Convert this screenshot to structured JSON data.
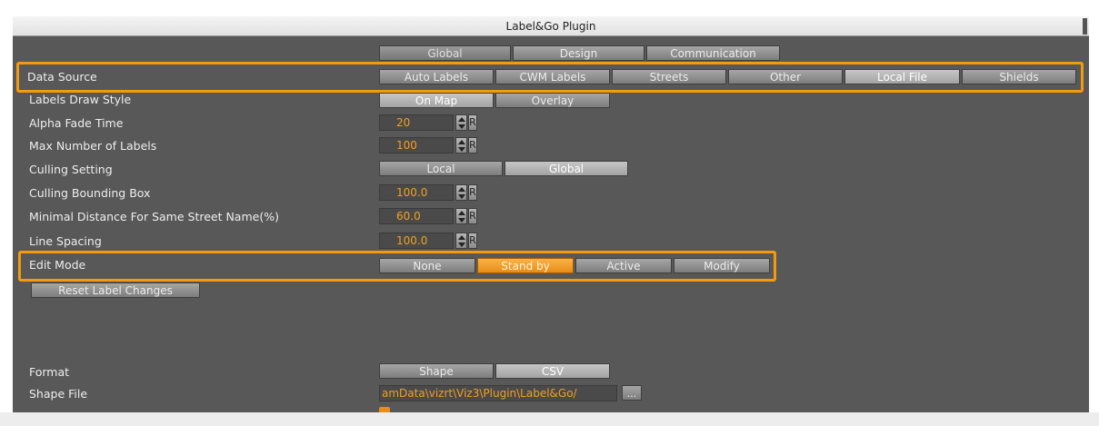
{
  "window": {
    "title": "Label&Go Plugin"
  },
  "tabs": [
    "Global",
    "Design",
    "Communication"
  ],
  "rows": {
    "data_source": {
      "label": "Data Source",
      "options": [
        "Auto Labels",
        "CWM Labels",
        "Streets",
        "Other",
        "Local File",
        "Shields"
      ],
      "selected": "Local File"
    },
    "labels_draw_style": {
      "label": "Labels Draw Style",
      "options": [
        "On Map",
        "Overlay"
      ],
      "selected": "On Map"
    },
    "alpha_fade_time": {
      "label": "Alpha Fade Time",
      "value": "20"
    },
    "max_labels": {
      "label": "Max Number of Labels",
      "value": "100"
    },
    "culling_setting": {
      "label": "Culling Setting",
      "options": [
        "Local",
        "Global"
      ],
      "selected": "Global"
    },
    "culling_bbox": {
      "label": "Culling Bounding Box",
      "value": "100.0"
    },
    "min_distance": {
      "label": "Minimal Distance For Same Street Name(%)",
      "value": "60.0"
    },
    "line_spacing": {
      "label": "Line Spacing",
      "value": "100.0"
    },
    "edit_mode": {
      "label": "Edit Mode",
      "options": [
        "None",
        "Stand by",
        "Active",
        "Modify"
      ],
      "selected": "Stand by"
    },
    "reset_button": "Reset Label Changes",
    "format": {
      "label": "Format",
      "options": [
        "Shape",
        "CSV"
      ],
      "selected": "CSV"
    },
    "shape_file": {
      "label": "Shape File",
      "value": "amData\\vizrt\\Viz3\\Plugin\\Label&Go/",
      "browse": "..."
    }
  },
  "controls": {
    "reset_glyph": "R"
  },
  "colors": {
    "highlight": "#f39a0e",
    "value_text": "#f0a020",
    "panel_bg": "#585858"
  }
}
